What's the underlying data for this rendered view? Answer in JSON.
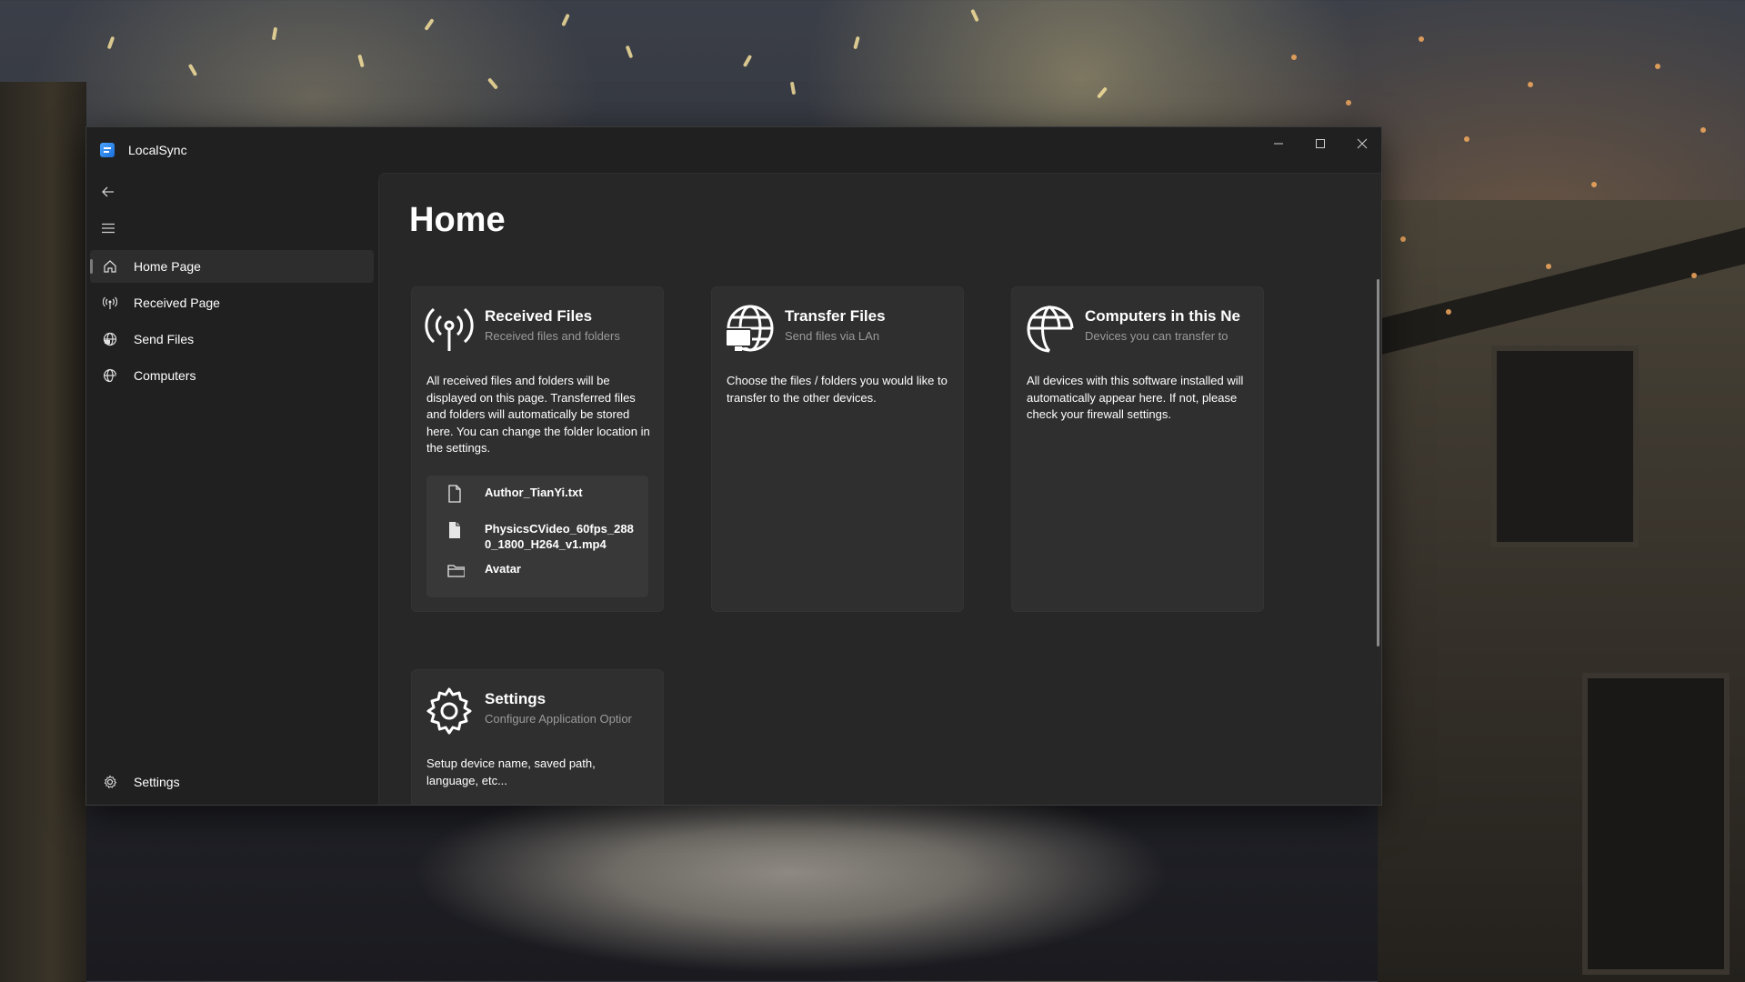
{
  "window": {
    "app_title": "LocalSync",
    "minimize_icon": "minimize-icon",
    "maximize_icon": "maximize-icon",
    "close_icon": "close-icon"
  },
  "sidebar": {
    "back_icon": "back-arrow-icon",
    "menu_icon": "hamburger-menu-icon",
    "items": [
      {
        "label": "Home Page",
        "icon": "home-icon",
        "selected": true
      },
      {
        "label": "Received Page",
        "icon": "broadcast-icon",
        "selected": false
      },
      {
        "label": "Send Files",
        "icon": "globe-icon",
        "selected": false
      },
      {
        "label": "Computers",
        "icon": "network-icon",
        "selected": false
      }
    ],
    "footer": {
      "label": "Settings",
      "icon": "gear-icon"
    }
  },
  "main": {
    "title": "Home",
    "cards": {
      "received": {
        "title": "Received Files",
        "subtitle": "Received files and folders",
        "description": "All received files and folders will be displayed on this page. Transferred files and folders will automatically be stored here. You can change the folder location in the settings.",
        "icon": "broadcast-icon",
        "files": [
          {
            "name": "Author_TianYi.txt",
            "type": "file"
          },
          {
            "name": "PhysicsCVideo_60fps_2880_1800_H264_v1.mp4",
            "type": "file"
          },
          {
            "name": "Avatar",
            "type": "folder"
          }
        ]
      },
      "transfer": {
        "title": "Transfer Files",
        "subtitle": "Send files via LAn",
        "description": "Choose the files / folders you would like to transfer to the other devices.",
        "icon": "globe-computer-icon"
      },
      "computers": {
        "title": "Computers in this Ne",
        "subtitle": "Devices you can transfer to",
        "description": "All devices with this software installed will automatically appear here. If not, please check your firewall settings.",
        "icon": "globe-network-icon"
      },
      "settings": {
        "title": "Settings",
        "subtitle": "Configure Application Optior",
        "description": "Setup device name, saved path, language, etc...",
        "icon": "gear-icon"
      }
    }
  }
}
